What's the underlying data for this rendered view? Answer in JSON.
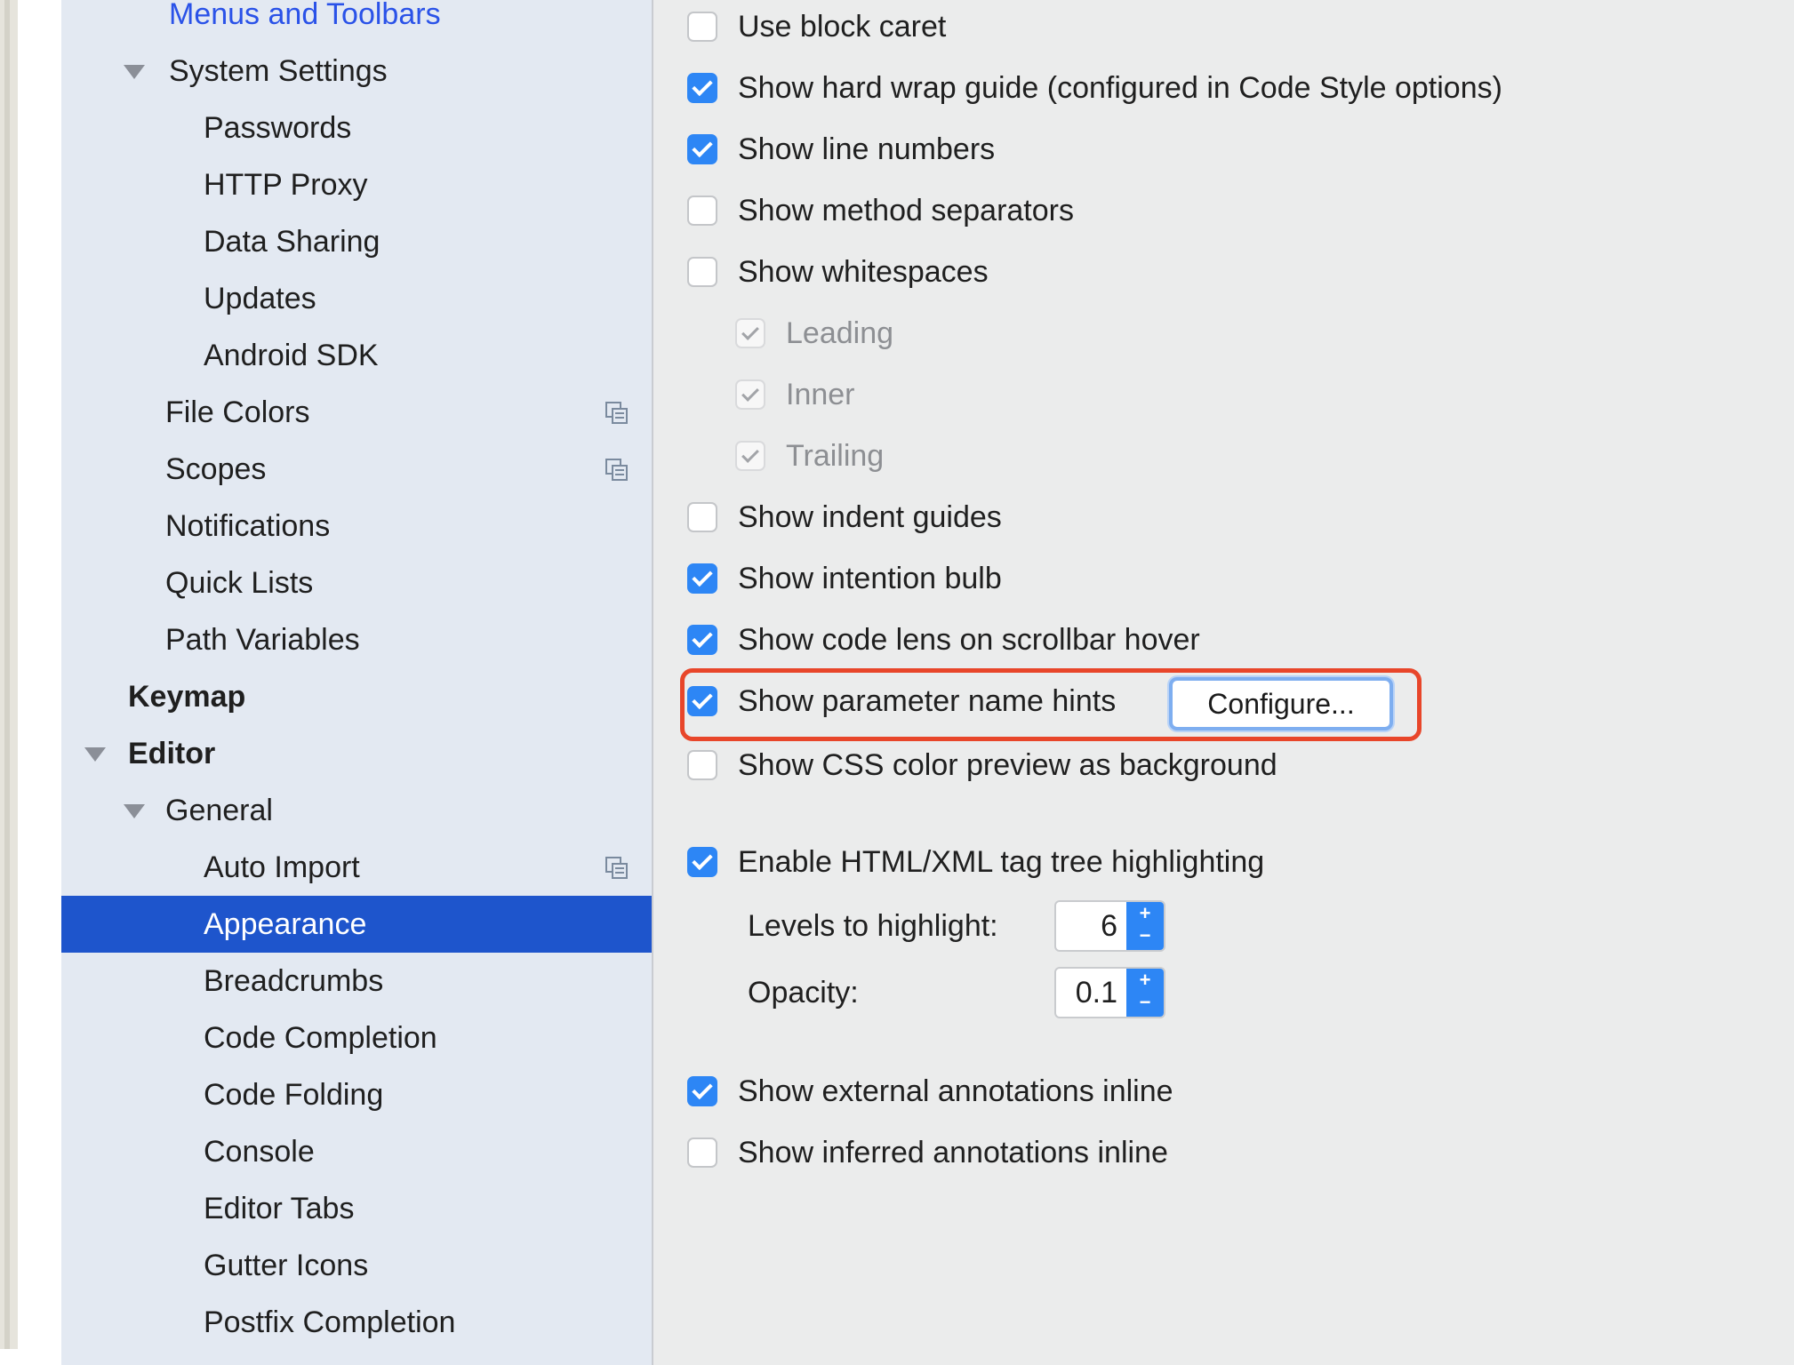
{
  "sidebar": {
    "items": [
      {
        "label": "Menus and Toolbars"
      },
      {
        "label": "System Settings"
      },
      {
        "label": "Passwords"
      },
      {
        "label": "HTTP Proxy"
      },
      {
        "label": "Data Sharing"
      },
      {
        "label": "Updates"
      },
      {
        "label": "Android SDK"
      },
      {
        "label": "File Colors"
      },
      {
        "label": "Scopes"
      },
      {
        "label": "Notifications"
      },
      {
        "label": "Quick Lists"
      },
      {
        "label": "Path Variables"
      },
      {
        "label": "Keymap"
      },
      {
        "label": "Editor"
      },
      {
        "label": "General"
      },
      {
        "label": "Auto Import"
      },
      {
        "label": "Appearance"
      },
      {
        "label": "Breadcrumbs"
      },
      {
        "label": "Code Completion"
      },
      {
        "label": "Code Folding"
      },
      {
        "label": "Console"
      },
      {
        "label": "Editor Tabs"
      },
      {
        "label": "Gutter Icons"
      },
      {
        "label": "Postfix Completion"
      }
    ],
    "selected": "Appearance"
  },
  "options": [
    {
      "label": "Use block caret",
      "checked": false
    },
    {
      "label": "Show hard wrap guide (configured in Code Style options)",
      "checked": true
    },
    {
      "label": "Show line numbers",
      "checked": true
    },
    {
      "label": "Show method separators",
      "checked": false
    },
    {
      "label": "Show whitespaces",
      "checked": false
    },
    {
      "label": "Leading",
      "checked": true,
      "disabled": true
    },
    {
      "label": "Inner",
      "checked": true,
      "disabled": true
    },
    {
      "label": "Trailing",
      "checked": true,
      "disabled": true
    },
    {
      "label": "Show indent guides",
      "checked": false
    },
    {
      "label": "Show intention bulb",
      "checked": true
    },
    {
      "label": "Show code lens on scrollbar hover",
      "checked": true
    },
    {
      "label": "Show parameter name hints",
      "checked": true
    },
    {
      "label": "Show CSS color preview as background",
      "checked": false
    },
    {
      "label": "Enable HTML/XML tag tree highlighting",
      "checked": true
    },
    {
      "label": "Show external annotations inline",
      "checked": true
    },
    {
      "label": "Show inferred annotations inline",
      "checked": false
    }
  ],
  "configure_button": "Configure...",
  "levels": {
    "label": "Levels to highlight:",
    "value": "6"
  },
  "opacity": {
    "label": "Opacity:",
    "value": "0.1"
  },
  "spinner_glyphs": {
    "plus": "+",
    "minus": "−"
  },
  "colors": {
    "selection": "#1e55cc",
    "checkbox_checked": "#2d86f5",
    "highlight_box": "#e8462a",
    "link": "#2a52e8"
  },
  "icons": {
    "tree_expand": "triangle-down-icon",
    "shared_settings": "copy-icon"
  }
}
